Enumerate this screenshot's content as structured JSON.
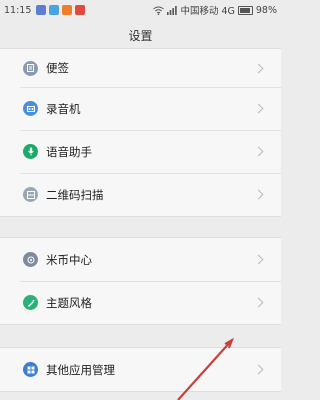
{
  "status_bar": {
    "time": "11:15",
    "carrier": "中国移动 4G",
    "battery": "98%",
    "notification_colors": [
      "#5a7fd3",
      "#4aa3df",
      "#f07d2a",
      "#e04a3a"
    ]
  },
  "header": {
    "title": "设置"
  },
  "sections": [
    [
      {
        "label": "便签",
        "icon": "note-icon",
        "color": "#8a9bb0"
      },
      {
        "label": "录音机",
        "icon": "recorder-icon",
        "color": "#4a90d9"
      },
      {
        "label": "语音助手",
        "icon": "mic-icon",
        "color": "#1aaa6a"
      },
      {
        "label": "二维码扫描",
        "icon": "qr-scan-icon",
        "color": "#9aa5b5"
      }
    ],
    [
      {
        "label": "米币中心",
        "icon": "coin-icon",
        "color": "#7e8aa0"
      },
      {
        "label": "主题风格",
        "icon": "theme-icon",
        "color": "#2bb07a"
      }
    ],
    [
      {
        "label": "其他应用管理",
        "icon": "apps-icon",
        "color": "#3f7ed8"
      }
    ]
  ]
}
